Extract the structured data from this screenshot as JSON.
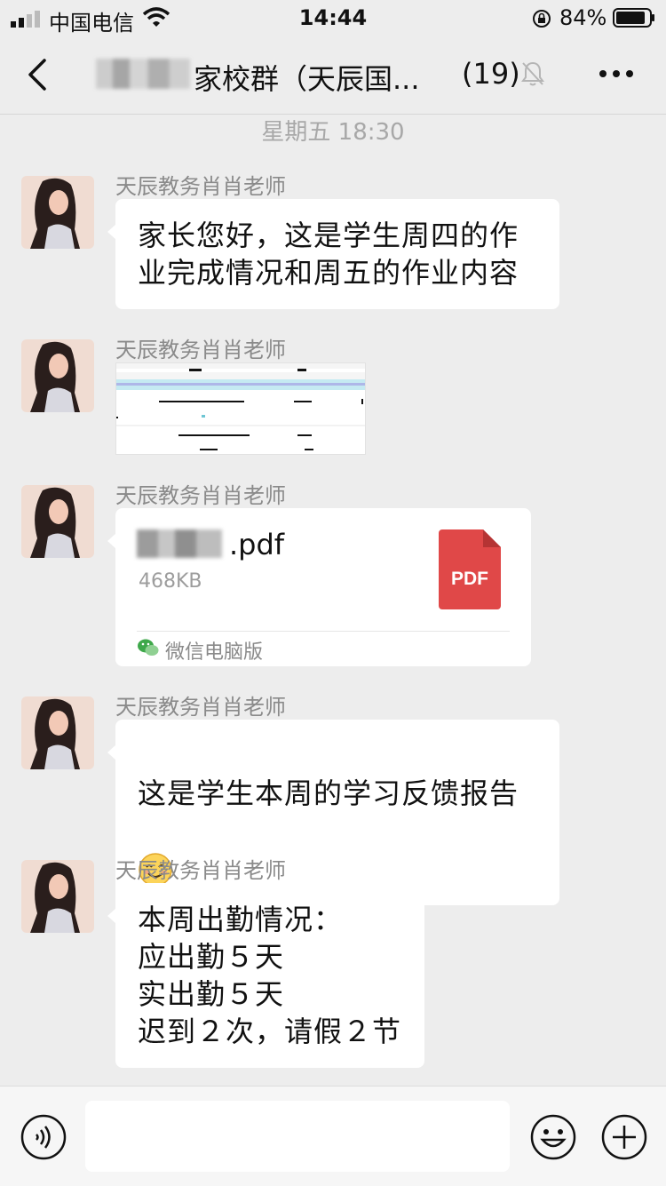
{
  "status": {
    "carrier": "中国电信",
    "time": "14:44",
    "battery": "84%"
  },
  "nav": {
    "title": "家校群（天辰国...",
    "member_count": "(19)"
  },
  "timestamp": "星期五 18:30",
  "messages": [
    {
      "sender": "天辰教务肖肖老师",
      "text": "家长您好，这是学生周四的作\n业完成情况和周五的作业内容"
    },
    {
      "sender": "天辰教务肖肖老师",
      "type": "image"
    },
    {
      "sender": "天辰教务肖肖老师",
      "type": "file",
      "file_name": ".pdf",
      "file_size": "468KB",
      "file_badge": "PDF",
      "file_source": "微信电脑版"
    },
    {
      "sender": "天辰教务肖肖老师",
      "text": "这是学生本周的学习反馈报告"
    },
    {
      "sender": "天辰教务肖肖老师",
      "text": "本周出勤情况：\n应出勤５天\n实出勤５天\n迟到２次，请假２节"
    }
  ],
  "colors": {
    "background": "#ededed",
    "bubble": "#ffffff",
    "pdf_red": "#e04848",
    "sender_gray": "#8a8a8a",
    "wechat_green": "#3ea84a"
  },
  "icons": [
    "back-icon",
    "mute-icon",
    "more-icon",
    "voice-icon",
    "emoji-icon",
    "plus-icon",
    "pdf-icon",
    "wechat-icon",
    "smile-emoji"
  ]
}
